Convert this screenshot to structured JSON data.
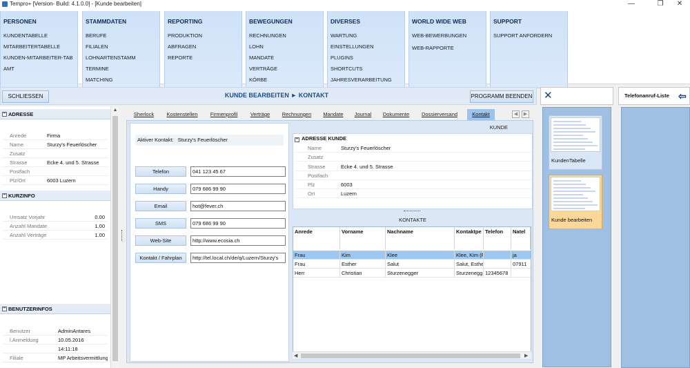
{
  "window": {
    "title": "Tempro+  [Version- Build: 4.1.0.0]  - [Kunde bearbeiten]"
  },
  "ribbon": [
    {
      "title": "PERSONEN",
      "items": [
        "KUNDENTABELLE",
        "MITARBEITERTABELLE",
        "KUNDEN-MITARBEITER-TAB",
        "AMT"
      ]
    },
    {
      "title": "STAMMDATEN",
      "items": [
        "BERUFE",
        "FILIALEN",
        "LOHNARTENSTAMM",
        "TERMINE",
        "MATCHING"
      ]
    },
    {
      "title": "REPORTING",
      "items": [
        "PRODUKTION",
        "ABFRAGEN",
        "REPORTE"
      ]
    },
    {
      "title": "BEWEGUNGEN",
      "items": [
        "RECHNUNGEN",
        "LOHN",
        "MANDATE",
        "VERTRÄGE",
        "KÖRBE"
      ]
    },
    {
      "title": "DIVERSES",
      "items": [
        "WARTUNG",
        "EINSTELLUNGEN",
        "PLUGINS",
        "SHORTCUTS",
        "JAHRESVERARBEITUNG"
      ]
    },
    {
      "title": "WORLD WIDE WEB",
      "items": [
        "WEB-BEWERBUNGEN",
        "WEB-RAPPORTE"
      ]
    },
    {
      "title": "SUPPORT",
      "items": [
        "SUPPORT ANFORDERN"
      ]
    }
  ],
  "toolbar": {
    "close_label": "SCHLIESSEN",
    "page_title": "KUNDE BEARBEITEN ► KONTAKT",
    "end_label": "PROGRAMM BEENDEN"
  },
  "left": {
    "adresse": {
      "title": "ADRESSE",
      "rows": [
        {
          "label": "Anrede",
          "value": "Firma"
        },
        {
          "label": "Name",
          "value": "Sturzy's Feuerlöscher"
        },
        {
          "label": "Zusatz",
          "value": ""
        },
        {
          "label": "Strasse",
          "value": "Ecke 4. und 5. Strasse"
        },
        {
          "label": "Postfach",
          "value": ""
        },
        {
          "label": "Plz/Ort",
          "value": "6003 Luzern"
        }
      ]
    },
    "kurzinfo": {
      "title": "KURZINFO",
      "rows": [
        {
          "label": "Umsatz Vorjahr",
          "value": "0.00"
        },
        {
          "label": "Anzahl Mandate",
          "value": "1.00"
        },
        {
          "label": "Anzahl Verträge",
          "value": "1.00"
        }
      ]
    },
    "benutzer": {
      "title": "BENUTZERINFOS",
      "rows": [
        {
          "label": "Benutzer",
          "value": "AdminAntares"
        },
        {
          "label": "l.Anmeldung",
          "value": "10.05.2016"
        },
        {
          "label": "",
          "value": "14:11:18"
        },
        {
          "label": "Filiale",
          "value": "MP Arbeitsvermittlung"
        }
      ]
    }
  },
  "tabs": [
    "Sherlock",
    "Kostenstellen",
    "Firmenprofil",
    "Verträge",
    "Rechnungen",
    "Mandate",
    "Journal",
    "Dokumente",
    "Dossierversand",
    "Kontakt"
  ],
  "kontakt": {
    "aktiver_label": "Aktiver Kontakt:",
    "aktiver_value": "Sturzy's Feuerlöscher",
    "fields": [
      {
        "label": "Telefon",
        "value": "041 123 45 67"
      },
      {
        "label": "Handy",
        "value": "079 686 99 90"
      },
      {
        "label": "Email",
        "value": "hot@fever.ch"
      },
      {
        "label": "SMS",
        "value": "079 686 99 90"
      },
      {
        "label": "Web-Site",
        "value": "http://www.ecosia.ch"
      },
      {
        "label": "Kontakt / Fahrplan",
        "value": "http://tel.local.ch/de/q/Luzern/Sturzy's"
      }
    ]
  },
  "kunde": {
    "header": "KUNDE",
    "adresse_title": "ADRESSE KUNDE",
    "rows": [
      {
        "label": "Name",
        "value": "Sturzy's Feuerlöscher"
      },
      {
        "label": "Zusatz",
        "value": ""
      },
      {
        "label": "Strasse",
        "value": "Ecke 4. und 5. Strasse"
      },
      {
        "label": "Postfach",
        "value": ""
      },
      {
        "label": "Plz",
        "value": "6003"
      },
      {
        "label": "Ort",
        "value": "Luzern"
      }
    ]
  },
  "kontakte": {
    "header": "KONTAKTE",
    "columns": [
      "Anrede",
      "Vorname",
      "Nachname",
      "Kontaktpe",
      "Telefon",
      "Natel"
    ],
    "rows": [
      [
        "Frau",
        "Kim",
        "Klee",
        "Klee, Kim (F",
        "",
        "ja"
      ],
      [
        "Frau",
        "Esther",
        "Salut",
        "Salut, Esthe",
        "",
        "07911"
      ],
      [
        "Herr",
        "Christian",
        "Sturzenegger",
        "Sturzenegg",
        "12345678",
        ""
      ]
    ]
  },
  "side": {
    "thumbs": [
      {
        "label": "KundenTabelle"
      },
      {
        "label": "Kunde bearbeiten"
      }
    ],
    "tel_title": "Telefonanruf-Liste"
  }
}
